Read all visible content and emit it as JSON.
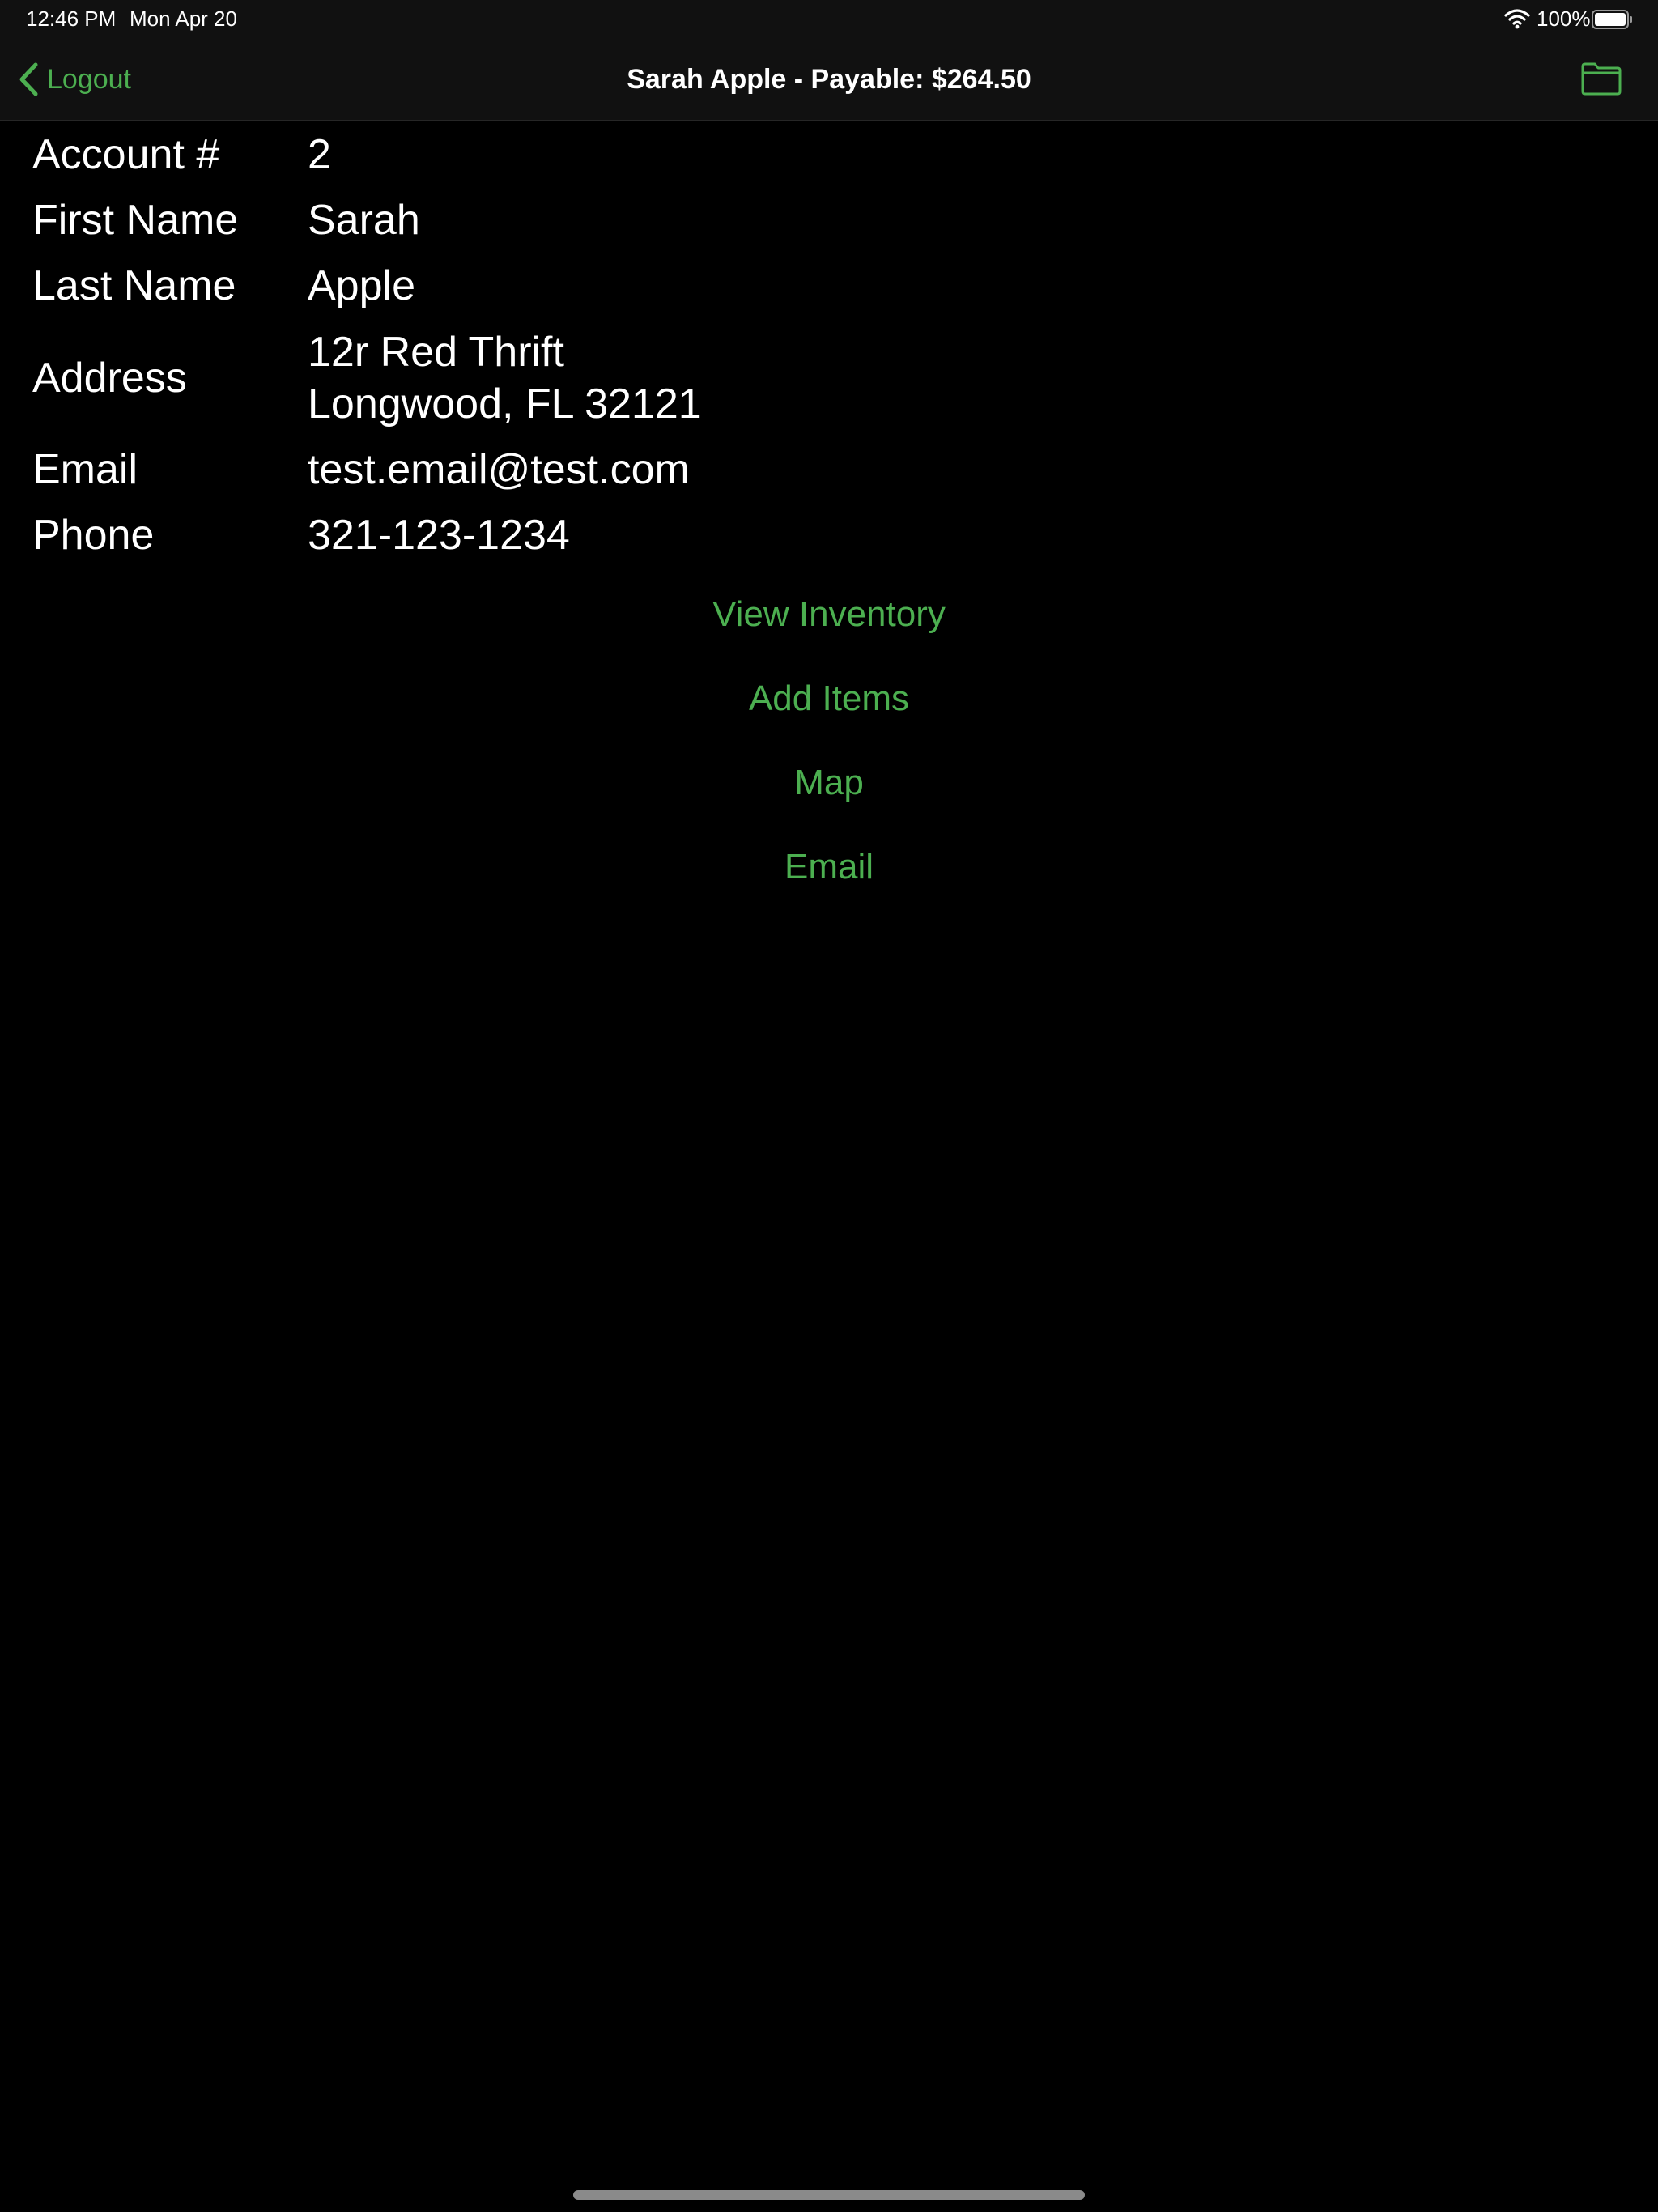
{
  "status_bar": {
    "time": "12:46 PM",
    "date": "Mon Apr 20",
    "battery": "100%",
    "wifi_icon": "wifi-icon",
    "battery_icon": "battery-icon"
  },
  "nav": {
    "back_label": "Logout",
    "back_icon": "chevron-left-icon",
    "title": "Sarah Apple - Payable: $264.50",
    "folder_icon": "folder-icon"
  },
  "details": {
    "account": {
      "label": "Account #",
      "value": "2"
    },
    "first_name": {
      "label": "First Name",
      "value": "Sarah"
    },
    "last_name": {
      "label": "Last Name",
      "value": "Apple"
    },
    "address": {
      "label": "Address",
      "line1": "12r Red Thrift",
      "line2": "Longwood, FL 32121"
    },
    "email": {
      "label": "Email",
      "value": "test.email@test.com"
    },
    "phone": {
      "label": "Phone",
      "value": "321-123-1234"
    }
  },
  "actions": {
    "view_inventory": "View Inventory",
    "add_items": "Add Items",
    "map": "Map",
    "email": "Email"
  },
  "colors": {
    "accent": "#4CAF50",
    "background": "#000000",
    "bar": "#111111",
    "text": "#ffffff"
  }
}
